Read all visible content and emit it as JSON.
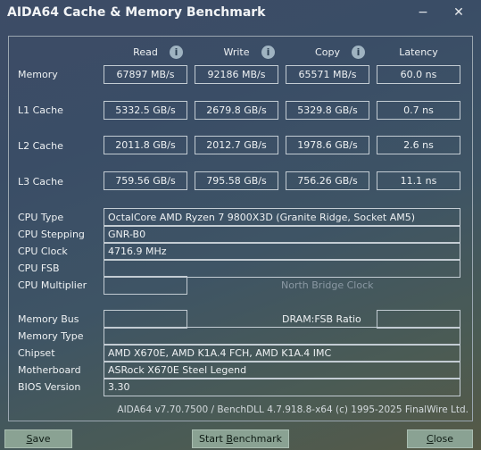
{
  "window": {
    "title": "AIDA64 Cache & Memory Benchmark",
    "minimize_label": "−",
    "close_label": "✕"
  },
  "columns": {
    "read": "Read",
    "write": "Write",
    "copy": "Copy",
    "latency": "Latency",
    "info_glyph": "i"
  },
  "rows": [
    {
      "label": "Memory",
      "read": "67897 MB/s",
      "write": "92186 MB/s",
      "copy": "65571 MB/s",
      "latency": "60.0 ns"
    },
    {
      "label": "L1 Cache",
      "read": "5332.5 GB/s",
      "write": "2679.8 GB/s",
      "copy": "5329.8 GB/s",
      "latency": "0.7 ns"
    },
    {
      "label": "L2 Cache",
      "read": "2011.8 GB/s",
      "write": "2012.7 GB/s",
      "copy": "1978.6 GB/s",
      "latency": "2.6 ns"
    },
    {
      "label": "L3 Cache",
      "read": "759.56 GB/s",
      "write": "795.58 GB/s",
      "copy": "756.26 GB/s",
      "latency": "11.1 ns"
    }
  ],
  "cpu": {
    "type_label": "CPU Type",
    "type_value": "OctalCore AMD Ryzen 7 9800X3D  (Granite Ridge, Socket AM5)",
    "stepping_label": "CPU Stepping",
    "stepping_value": "GNR-B0",
    "clock_label": "CPU Clock",
    "clock_value": "4716.9 MHz",
    "fsb_label": "CPU FSB",
    "fsb_value": "",
    "multiplier_label": "CPU Multiplier",
    "multiplier_value": "",
    "north_bridge_label": "North Bridge Clock"
  },
  "system": {
    "memory_bus_label": "Memory Bus",
    "memory_bus_value": "",
    "dram_fsb_label": "DRAM:FSB Ratio",
    "dram_fsb_value": "",
    "memory_type_label": "Memory Type",
    "memory_type_value": "",
    "chipset_label": "Chipset",
    "chipset_value": "AMD X670E, AMD K1A.4 FCH, AMD K1A.4 IMC",
    "motherboard_label": "Motherboard",
    "motherboard_value": "ASRock X670E Steel Legend",
    "bios_label": "BIOS Version",
    "bios_value": "3.30"
  },
  "footer": "AIDA64 v7.70.7500 / BenchDLL 4.7.918.8-x64  (c) 1995-2025 FinalWire Ltd.",
  "buttons": {
    "save_first": "S",
    "save_rest": "ave",
    "start_pre": "Start ",
    "start_ul": "B",
    "start_rest": "enchmark",
    "close_first": "C",
    "close_rest": "lose"
  }
}
